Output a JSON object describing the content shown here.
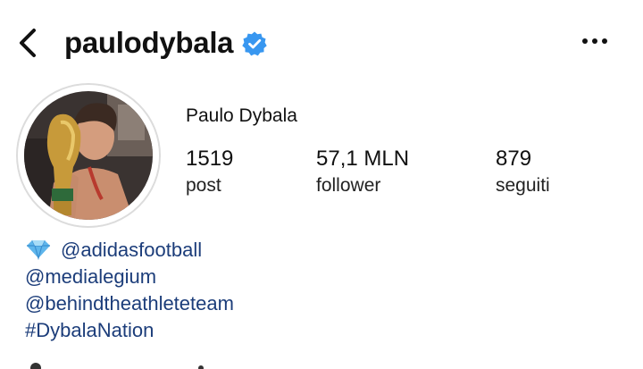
{
  "header": {
    "back_icon": "chevron-left-icon",
    "username": "paulodybala",
    "verified_icon": "verified-badge-icon",
    "more_icon": "more-horizontal-icon"
  },
  "profile": {
    "display_name": "Paulo Dybala",
    "avatar_icon": "avatar",
    "stats": {
      "posts": {
        "value": "1519",
        "label": "post"
      },
      "followers": {
        "value": "57,1 MLN",
        "label": "follower"
      },
      "following": {
        "value": "879",
        "label": "seguiti"
      }
    }
  },
  "bio": {
    "line1_icon": "gem-icon",
    "line1": "@adidasfootball",
    "line2": "@medialegium",
    "line3": "@behindtheathleteteam",
    "line4": "#DybalaNation"
  },
  "colors": {
    "link": "#1c3d7a",
    "verified_badge": "#3897f0",
    "text": "#111111"
  }
}
